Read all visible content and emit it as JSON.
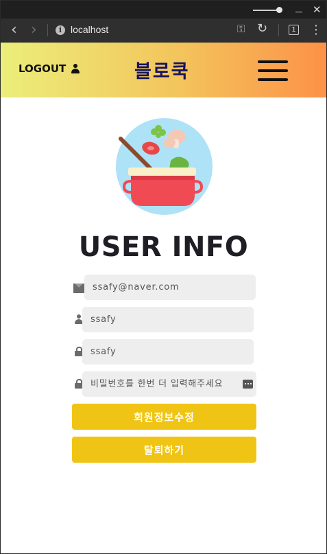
{
  "browser": {
    "url": "localhost",
    "tab_count": "1"
  },
  "header": {
    "logout_label": "LOGOUT",
    "brand": "블로쿡"
  },
  "page": {
    "title": "USER INFO"
  },
  "form": {
    "email_value": "ssafy@naver.com",
    "name_value": "ssafy",
    "password_value": "ssafy",
    "confirm_placeholder": "비밀번호를 한번 더 입력해주세요",
    "update_button": "회원정보수정",
    "withdraw_button": "탈퇴하기"
  },
  "colors": {
    "header_gradient": [
      "#ecee7a",
      "#fd9147"
    ],
    "brand_text": "#17135c",
    "button": "#f0c414",
    "field_bg": "#eeeeee"
  },
  "icons": {
    "logo": "cooking-pot-logo-icon",
    "email": "envelope-icon",
    "name": "user-icon",
    "password": "lock-icon"
  }
}
